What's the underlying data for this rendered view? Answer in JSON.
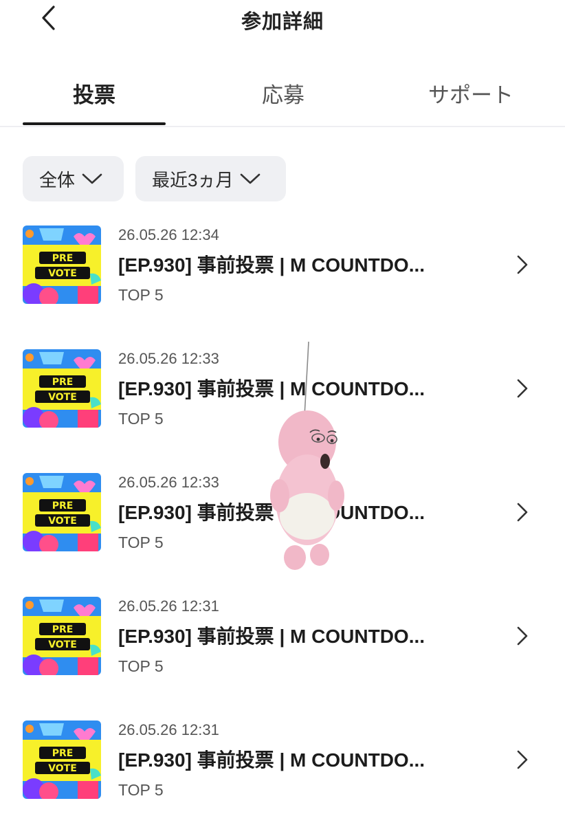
{
  "header": {
    "title": "参加詳細",
    "back_icon": "chevron-left-icon"
  },
  "tabs": [
    {
      "label": "投票",
      "active": true
    },
    {
      "label": "応募",
      "active": false
    },
    {
      "label": "サポート",
      "active": false
    }
  ],
  "filters": [
    {
      "label": "全体",
      "icon": "chevron-down-icon"
    },
    {
      "label": "最近3ヵ月",
      "icon": "chevron-down-icon"
    }
  ],
  "thumbnail": {
    "line1": "PRE",
    "line2": "VOTE"
  },
  "items": [
    {
      "date": "26.05.26 12:34",
      "title": "[EP.930] 事前投票 | M COUNTDO...",
      "sub": "TOP 5"
    },
    {
      "date": "26.05.26 12:33",
      "title": "[EP.930] 事前投票 | M COUNTDO...",
      "sub": "TOP 5"
    },
    {
      "date": "26.05.26 12:33",
      "title": "[EP.930] 事前投票 | M COUNTDO...",
      "sub": "TOP 5"
    },
    {
      "date": "26.05.26 12:31",
      "title": "[EP.930] 事前投票 | M COUNTDO...",
      "sub": "TOP 5"
    },
    {
      "date": "26.05.26 12:31",
      "title": "[EP.930] 事前投票 | M COUNTDO...",
      "sub": "TOP 5"
    }
  ],
  "colors": {
    "accent": "#1a1a1a",
    "filter_bg": "#eff0f3",
    "thumb_bg": "#2f8df0",
    "thumb_banner": "#f7f02a"
  }
}
